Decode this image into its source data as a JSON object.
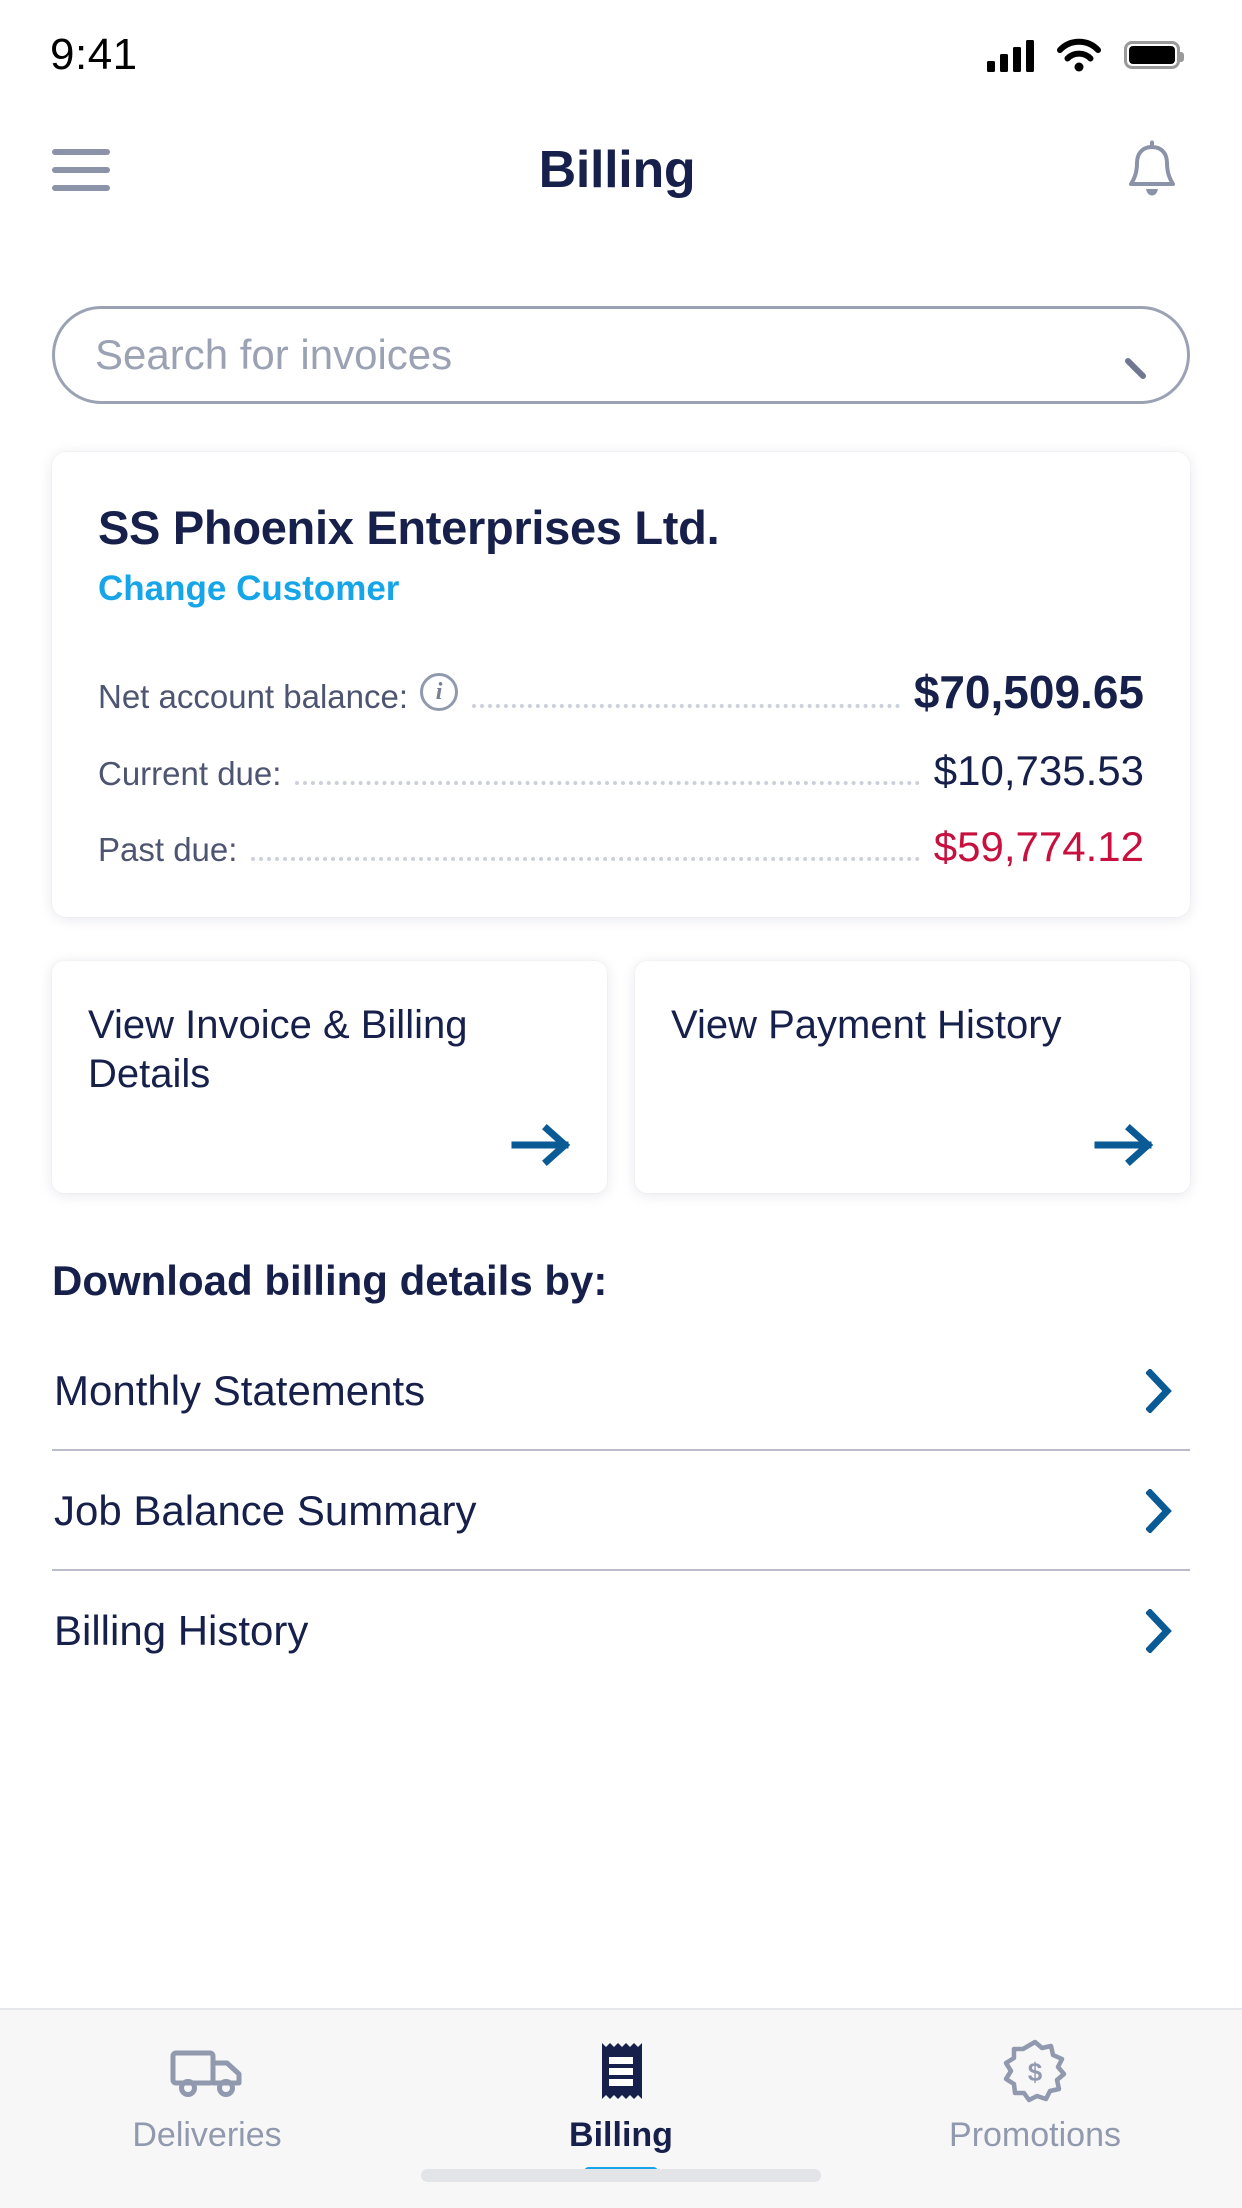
{
  "status_bar": {
    "time": "9:41",
    "signal_icon": "cellular-signal-icon",
    "wifi_icon": "wifi-icon",
    "battery_icon": "battery-full-icon"
  },
  "header": {
    "menu_icon": "hamburger-menu-icon",
    "title": "Billing",
    "notification_icon": "bell-icon"
  },
  "search": {
    "placeholder": "Search for invoices",
    "value": "",
    "icon": "search-icon"
  },
  "customer_card": {
    "name": "SS Phoenix Enterprises Ltd.",
    "change_link": "Change Customer",
    "balances": [
      {
        "label": "Net account balance:",
        "value": "$70,509.65",
        "has_info_icon": true,
        "style": "primary",
        "color": "#16204a"
      },
      {
        "label": "Current due:",
        "value": "$10,735.53",
        "has_info_icon": false,
        "style": "normal",
        "color": "#16204a"
      },
      {
        "label": "Past due:",
        "value": "$59,774.12",
        "has_info_icon": false,
        "style": "past-due",
        "color": "#c8103f"
      }
    ],
    "info_icon": "info-circle-icon"
  },
  "action_cards": [
    {
      "title": "View Invoice & Billing Details",
      "arrow_icon": "arrow-right-icon"
    },
    {
      "title": "View Payment History",
      "arrow_icon": "arrow-right-icon"
    }
  ],
  "download_section": {
    "heading": "Download billing details by:",
    "items": [
      {
        "label": "Monthly Statements",
        "chevron_icon": "chevron-right-icon"
      },
      {
        "label": "Job Balance Summary",
        "chevron_icon": "chevron-right-icon"
      },
      {
        "label": "Billing History",
        "chevron_icon": "chevron-right-icon"
      }
    ]
  },
  "tab_bar": {
    "tabs": [
      {
        "label": "Deliveries",
        "icon": "truck-icon",
        "active": false
      },
      {
        "label": "Billing",
        "icon": "receipt-icon",
        "active": true
      },
      {
        "label": "Promotions",
        "icon": "badge-dollar-icon",
        "active": false
      }
    ]
  },
  "colors": {
    "navy": "#16204a",
    "cyan": "#16a5e8",
    "blue_arrow": "#0a5a96",
    "red": "#c8103f",
    "gray_text": "#9199ae"
  }
}
